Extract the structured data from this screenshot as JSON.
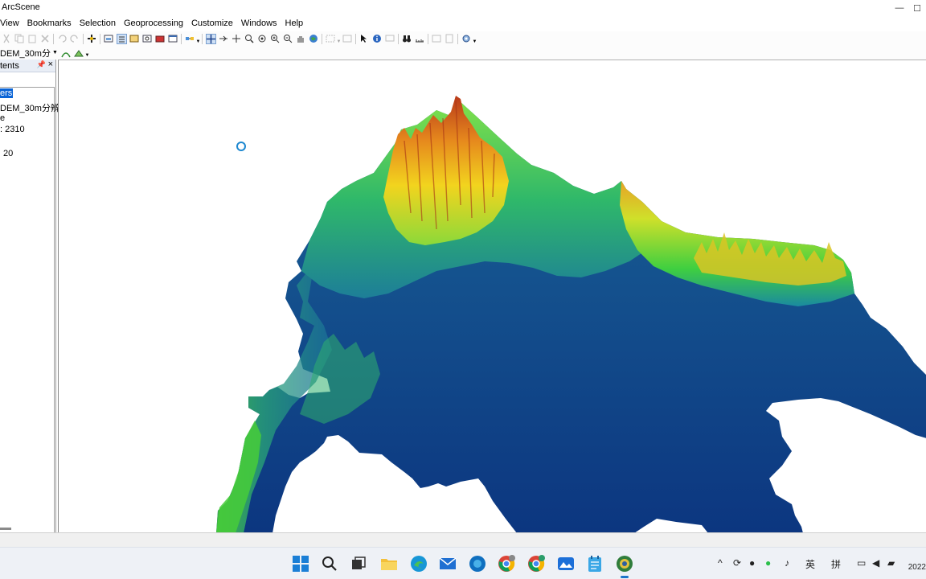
{
  "window": {
    "title": "ArcScene"
  },
  "menu": [
    "View",
    "Bookmarks",
    "Selection",
    "Geoprocessing",
    "Customize",
    "Windows",
    "Help"
  ],
  "toolbar": {
    "layer_selector": "DEM_30m分"
  },
  "toc": {
    "title": "tents",
    "rows": [
      {
        "text": "ers",
        "selected": true
      },
      {
        "text": "DEM_30m分辨",
        "selected": false
      },
      {
        "text": "e",
        "selected": false
      },
      {
        "text": ": 2310",
        "selected": false
      },
      {
        "text": "20",
        "selected": false
      }
    ]
  },
  "taskbar": {
    "ime_lang": "英",
    "ime_mode": "拼",
    "clock": "2022"
  },
  "colors": {
    "selection": "#0a64d6",
    "dem_low": "#0d3a86",
    "dem_mid": "#1f8fa0",
    "dem_green": "#39d12e",
    "dem_yellow": "#f1d21c",
    "dem_high": "#c6461c"
  }
}
